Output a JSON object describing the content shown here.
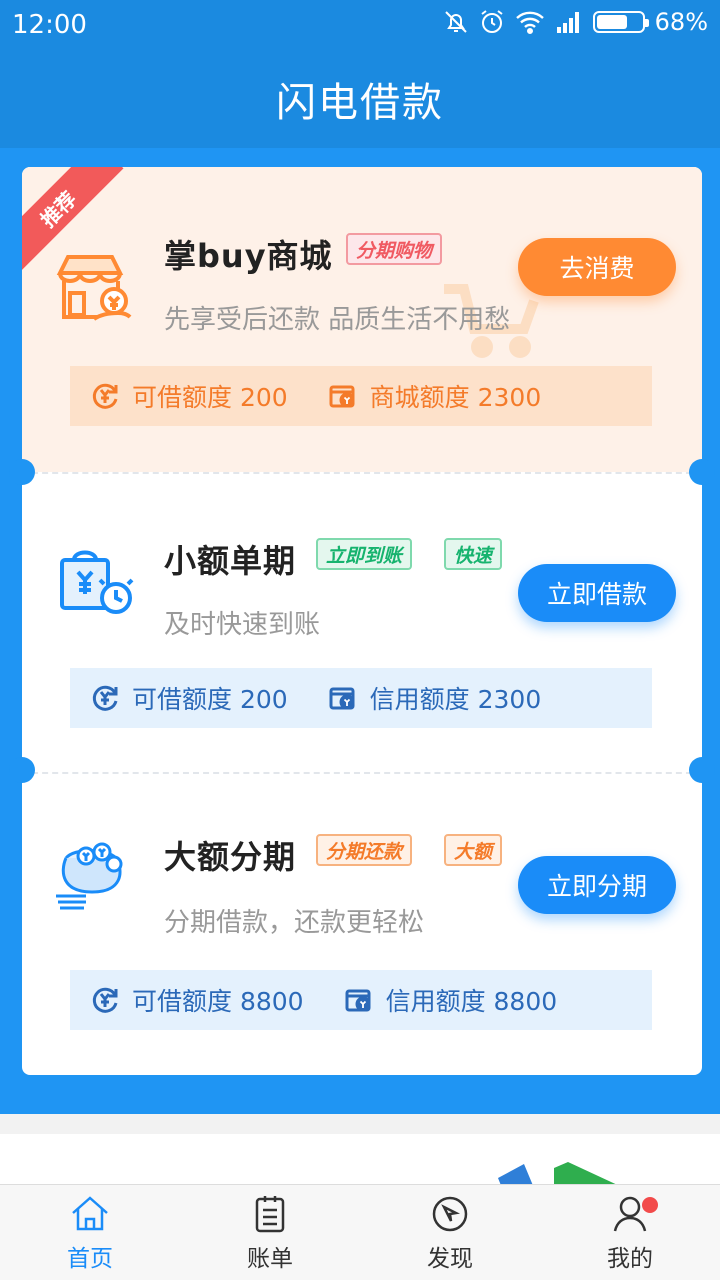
{
  "status_bar": {
    "time": "12:00",
    "battery_percent": "68%",
    "battery_level": 0.68,
    "icons": [
      "bell-off-icon",
      "alarm-icon",
      "wifi-icon",
      "signal-icon",
      "battery-icon"
    ]
  },
  "header": {
    "title": "闪电借款"
  },
  "products": [
    {
      "ribbon": "推荐",
      "title": "掌buy商城",
      "tags": [
        "分期购物"
      ],
      "subtitle": "先享受后还款 品质生活不用愁",
      "button": "去消费",
      "quota_left": "可借额度 200",
      "quota_right": "商城额度 2300",
      "icon": "shop-icon"
    },
    {
      "title": "小额单期",
      "tags": [
        "立即到账",
        "快速"
      ],
      "subtitle": "及时快速到账",
      "button": "立即借款",
      "quota_left": "可借额度 200",
      "quota_right": "信用额度 2300",
      "icon": "shopping-bag-clock-icon"
    },
    {
      "title": "大额分期",
      "tags": [
        "分期还款",
        "大额"
      ],
      "subtitle": "分期借款，还款更轻松",
      "button": "立即分期",
      "quota_left": "可借额度 8800",
      "quota_right": "信用额度 8800",
      "icon": "money-bag-icon"
    }
  ],
  "tabbar": [
    {
      "label": "首页",
      "icon": "home-icon",
      "active": true
    },
    {
      "label": "账单",
      "icon": "bill-icon",
      "active": false
    },
    {
      "label": "发现",
      "icon": "compass-icon",
      "active": false
    },
    {
      "label": "我的",
      "icon": "user-icon",
      "active": false,
      "badge": true
    }
  ],
  "colors": {
    "primary": "#1b8ae0",
    "panel": "#1f95f3",
    "orange": "#ff8a33",
    "button_blue": "#1a8cf8"
  }
}
